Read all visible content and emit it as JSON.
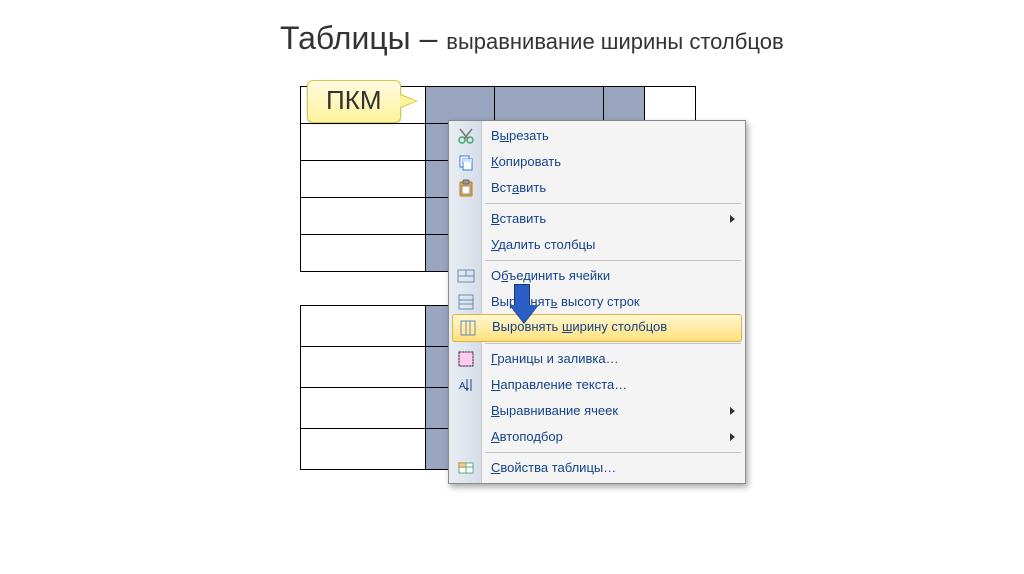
{
  "title_main": "Таблицы – ",
  "title_sub": "выравнивание ширины столбцов",
  "callout_label": "ПКМ",
  "menu": {
    "cut": "В<u>ы</u>резать",
    "copy": "<u>К</u>опировать",
    "paste": "Вст<u>а</u>вить",
    "insert": "<u>В</u>ставить",
    "delete_cols": "<u>У</u>далить столбцы",
    "merge": "О<u>б</u>ъединить ячейки",
    "dist_rows": "Выровнят<u>ь</u> высоту строк",
    "dist_cols": "Выровнять <u>ш</u>ирину столбцов",
    "borders": "<u>Г</u>раницы и заливка…",
    "text_dir": "<u>Н</u>аправление текста…",
    "align": "<u>В</u>ыравнивание ячеек",
    "autofit": "<u>А</u>втоподбор",
    "props": "<u>С</u>войства таблицы…"
  }
}
